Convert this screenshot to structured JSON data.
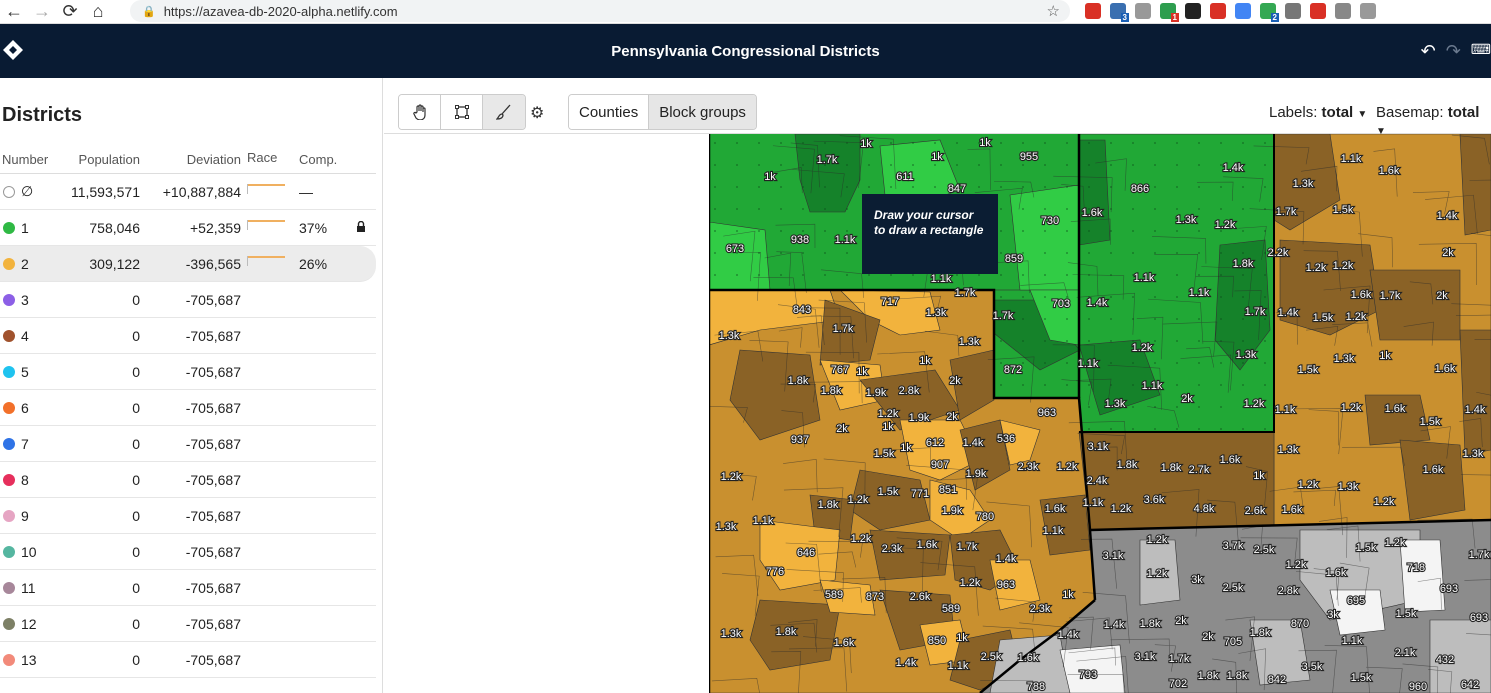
{
  "browser": {
    "url": "https://azavea-db-2020-alpha.netlify.com",
    "extension_badges": [
      "3",
      "1",
      "2"
    ]
  },
  "app": {
    "title": "Pennsylvania Congressional Districts"
  },
  "sidebar": {
    "heading": "Districts",
    "columns": {
      "number": "Number",
      "population": "Population",
      "deviation": "Deviation",
      "race": "Race",
      "comp": "Comp."
    },
    "rows": [
      {
        "number": "∅",
        "color": "#ffffff",
        "population": "11,593,571",
        "deviation": "+10,887,884",
        "comp": "—",
        "locked": false
      },
      {
        "number": "1",
        "color": "#2fb944",
        "population": "758,046",
        "deviation": "+52,359",
        "comp": "37%",
        "locked": true
      },
      {
        "number": "2",
        "color": "#f2b33d",
        "population": "309,122",
        "deviation": "-396,565",
        "comp": "26%",
        "locked": false
      },
      {
        "number": "3",
        "color": "#8c5fe6",
        "population": "0",
        "deviation": "-705,687",
        "comp": "",
        "locked": false
      },
      {
        "number": "4",
        "color": "#a0522d",
        "population": "0",
        "deviation": "-705,687",
        "comp": "",
        "locked": false
      },
      {
        "number": "5",
        "color": "#1fc3ef",
        "population": "0",
        "deviation": "-705,687",
        "comp": "",
        "locked": false
      },
      {
        "number": "6",
        "color": "#f2702a",
        "population": "0",
        "deviation": "-705,687",
        "comp": "",
        "locked": false
      },
      {
        "number": "7",
        "color": "#2f73e6",
        "population": "0",
        "deviation": "-705,687",
        "comp": "",
        "locked": false
      },
      {
        "number": "8",
        "color": "#e62f5c",
        "population": "0",
        "deviation": "-705,687",
        "comp": "",
        "locked": false
      },
      {
        "number": "9",
        "color": "#e6a5c3",
        "population": "0",
        "deviation": "-705,687",
        "comp": "",
        "locked": false
      },
      {
        "number": "10",
        "color": "#55b6a0",
        "population": "0",
        "deviation": "-705,687",
        "comp": "",
        "locked": false
      },
      {
        "number": "11",
        "color": "#a7879a",
        "population": "0",
        "deviation": "-705,687",
        "comp": "",
        "locked": false
      },
      {
        "number": "12",
        "color": "#7d8066",
        "population": "0",
        "deviation": "-705,687",
        "comp": "",
        "locked": false
      },
      {
        "number": "13",
        "color": "#f28a7a",
        "population": "0",
        "deviation": "-705,687",
        "comp": "",
        "locked": false
      }
    ]
  },
  "toolbar": {
    "tools": [
      "pan-icon",
      "rectangle-icon",
      "brush-icon"
    ],
    "active_tool": "brush-icon",
    "geo_levels": [
      "Counties",
      "Block groups"
    ],
    "active_geo_level": "Block groups",
    "labels_label": "Labels:",
    "labels_value": "total",
    "basemap_label": "Basemap:",
    "basemap_value": "total"
  },
  "map": {
    "tooltip": "Draw your cursor to draw a rectangle",
    "colors": {
      "green_dark": "#15822a",
      "green": "#21a836",
      "green_light": "#31cc45",
      "tan": "#c9902f",
      "orange": "#f2b33d",
      "brown": "#8a6226",
      "gray": "#8c8c8c",
      "gray_light": "#bdbdbd",
      "white": "#f4f4f4"
    },
    "labels": [
      [
        "1k",
        770,
        180
      ],
      [
        "1.7k",
        827,
        163
      ],
      [
        "1k",
        866,
        147
      ],
      [
        "1k",
        937,
        160
      ],
      [
        "1k",
        985,
        146
      ],
      [
        "955",
        1029,
        160
      ],
      [
        "611",
        905,
        180
      ],
      [
        "847",
        957,
        192
      ],
      [
        "673",
        735,
        252
      ],
      [
        "938",
        800,
        243
      ],
      [
        "1.1k",
        845,
        243
      ],
      [
        "730",
        1050,
        224
      ],
      [
        "859",
        1014,
        262
      ],
      [
        "1.1k",
        941,
        282
      ],
      [
        "1.7k",
        965,
        296
      ],
      [
        "866",
        1140,
        192
      ],
      [
        "1.4k",
        1233,
        171
      ],
      [
        "1.6k",
        1092,
        216
      ],
      [
        "1.3k",
        1186,
        223
      ],
      [
        "1.2k",
        1225,
        228
      ],
      [
        "1.1k",
        1144,
        281
      ],
      [
        "1.1k",
        1199,
        296
      ],
      [
        "1.8k",
        1243,
        267
      ],
      [
        "1.4k",
        1097,
        306
      ],
      [
        "1.7k",
        1255,
        315
      ],
      [
        "1.2k",
        1142,
        351
      ],
      [
        "1.3k",
        1246,
        358
      ],
      [
        "1.1k",
        1088,
        367
      ],
      [
        "1.1k",
        1152,
        389
      ],
      [
        "1.3k",
        1115,
        407
      ],
      [
        "2k",
        1187,
        402
      ],
      [
        "1.2k",
        1254,
        407
      ],
      [
        "1.1k",
        1351,
        162
      ],
      [
        "1.6k",
        1389,
        174
      ],
      [
        "1.3k",
        1303,
        187
      ],
      [
        "1.7k",
        1286,
        215
      ],
      [
        "1.5k",
        1343,
        213
      ],
      [
        "1.4k",
        1447,
        219
      ],
      [
        "2.2k",
        1278,
        256
      ],
      [
        "1.2k",
        1316,
        271
      ],
      [
        "1.2k",
        1343,
        269
      ],
      [
        "2k",
        1448,
        256
      ],
      [
        "1.6k",
        1361,
        298
      ],
      [
        "1.7k",
        1390,
        299
      ],
      [
        "2k",
        1442,
        299
      ],
      [
        "1.4k",
        1288,
        316
      ],
      [
        "1.5k",
        1323,
        321
      ],
      [
        "1.2k",
        1356,
        320
      ],
      [
        "1.5k",
        1308,
        373
      ],
      [
        "1.3k",
        1344,
        362
      ],
      [
        "1k",
        1385,
        359
      ],
      [
        "1.6k",
        1445,
        372
      ],
      [
        "1.1k",
        1285,
        413
      ],
      [
        "1.2k",
        1351,
        411
      ],
      [
        "1.6k",
        1395,
        412
      ],
      [
        "1.4k",
        1475,
        413
      ],
      [
        "1.5k",
        1430,
        425
      ],
      [
        "1.3k",
        1288,
        453
      ],
      [
        "1.6k",
        1433,
        473
      ],
      [
        "1.3k",
        1473,
        457
      ],
      [
        "1.2k",
        1308,
        488
      ],
      [
        "1.3k",
        1348,
        490
      ],
      [
        "1.2k",
        1384,
        505
      ],
      [
        "843",
        802,
        313
      ],
      [
        "717",
        890,
        305
      ],
      [
        "1.3k",
        936,
        316
      ],
      [
        "1.7k",
        1003,
        319
      ],
      [
        "703",
        1061,
        307
      ],
      [
        "1.3k",
        729,
        339
      ],
      [
        "1.7k",
        843,
        332
      ],
      [
        "1.3k",
        969,
        345
      ],
      [
        "872",
        1013,
        373
      ],
      [
        "1.8k",
        798,
        384
      ],
      [
        "767",
        840,
        373
      ],
      [
        "1k",
        862,
        375
      ],
      [
        "1k",
        925,
        364
      ],
      [
        "2k",
        955,
        384
      ],
      [
        "1.8k",
        831,
        394
      ],
      [
        "1.9k",
        876,
        396
      ],
      [
        "2.8k",
        909,
        394
      ],
      [
        "1.2k",
        888,
        417
      ],
      [
        "1.9k",
        919,
        421
      ],
      [
        "2k",
        952,
        420
      ],
      [
        "963",
        1047,
        416
      ],
      [
        "937",
        800,
        443
      ],
      [
        "2k",
        842,
        432
      ],
      [
        "1k",
        888,
        430
      ],
      [
        "612",
        935,
        446
      ],
      [
        "1.4k",
        973,
        446
      ],
      [
        "536",
        1006,
        442
      ],
      [
        "1.5k",
        884,
        457
      ],
      [
        "1k",
        906,
        451
      ],
      [
        "907",
        940,
        468
      ],
      [
        "1.9k",
        976,
        477
      ],
      [
        "2.3k",
        1028,
        470
      ],
      [
        "1.2k",
        1067,
        470
      ],
      [
        "1.2k",
        731,
        480
      ],
      [
        "1.5k",
        888,
        495
      ],
      [
        "771",
        920,
        497
      ],
      [
        "851",
        948,
        493
      ],
      [
        "1.8k",
        828,
        508
      ],
      [
        "1.2k",
        858,
        503
      ],
      [
        "1.9k",
        952,
        514
      ],
      [
        "780",
        985,
        520
      ],
      [
        "1.6k",
        1055,
        512
      ],
      [
        "1.3k",
        726,
        530
      ],
      [
        "1.1k",
        763,
        524
      ],
      [
        "1.1k",
        1053,
        534
      ],
      [
        "1.2k",
        861,
        542
      ],
      [
        "2.3k",
        892,
        552
      ],
      [
        "1.6k",
        927,
        548
      ],
      [
        "1.7k",
        967,
        550
      ],
      [
        "646",
        806,
        556
      ],
      [
        "1.4k",
        1006,
        562
      ],
      [
        "776",
        775,
        575
      ],
      [
        "589",
        834,
        598
      ],
      [
        "873",
        875,
        600
      ],
      [
        "2.6k",
        920,
        600
      ],
      [
        "1.2k",
        970,
        586
      ],
      [
        "963",
        1006,
        588
      ],
      [
        "1k",
        1068,
        598
      ],
      [
        "589",
        951,
        612
      ],
      [
        "2.3k",
        1040,
        612
      ],
      [
        "1.3k",
        731,
        637
      ],
      [
        "1.8k",
        786,
        635
      ],
      [
        "1.6k",
        844,
        646
      ],
      [
        "850",
        937,
        644
      ],
      [
        "1k",
        962,
        641
      ],
      [
        "1.4k",
        906,
        666
      ],
      [
        "1.1k",
        958,
        669
      ],
      [
        "2.5k",
        991,
        660
      ],
      [
        "1.6k",
        1028,
        661
      ],
      [
        "3.1k",
        1098,
        450
      ],
      [
        "1.8k",
        1127,
        468
      ],
      [
        "1.8k",
        1171,
        471
      ],
      [
        "2.7k",
        1199,
        473
      ],
      [
        "1.6k",
        1230,
        463
      ],
      [
        "1k",
        1259,
        479
      ],
      [
        "2.4k",
        1097,
        484
      ],
      [
        "1.1k",
        1093,
        506
      ],
      [
        "1.2k",
        1121,
        512
      ],
      [
        "3.6k",
        1154,
        503
      ],
      [
        "4.8k",
        1204,
        512
      ],
      [
        "2.6k",
        1255,
        514
      ],
      [
        "1.6k",
        1292,
        513
      ],
      [
        "1.2k",
        1157,
        543
      ],
      [
        "3.1k",
        1113,
        559
      ],
      [
        "1.2k",
        1157,
        577
      ],
      [
        "3.7k",
        1233,
        549
      ],
      [
        "2.5k",
        1264,
        553
      ],
      [
        "1.2k",
        1296,
        568
      ],
      [
        "1.5k",
        1366,
        551
      ],
      [
        "1.2k",
        1395,
        546
      ],
      [
        "1.7k",
        1479,
        558
      ],
      [
        "3k",
        1197,
        583
      ],
      [
        "2.5k",
        1233,
        591
      ],
      [
        "2.8k",
        1288,
        594
      ],
      [
        "1.6k",
        1336,
        576
      ],
      [
        "718",
        1416,
        571
      ],
      [
        "693",
        1449,
        592
      ],
      [
        "695",
        1356,
        604
      ],
      [
        "1.4k",
        1114,
        628
      ],
      [
        "1.8k",
        1150,
        627
      ],
      [
        "2k",
        1181,
        624
      ],
      [
        "2k",
        1208,
        640
      ],
      [
        "705",
        1233,
        645
      ],
      [
        "1.8k",
        1260,
        636
      ],
      [
        "870",
        1300,
        627
      ],
      [
        "3k",
        1333,
        618
      ],
      [
        "1.5k",
        1406,
        617
      ],
      [
        "693",
        1479,
        621
      ],
      [
        "1.4k",
        1068,
        638
      ],
      [
        "1.1k",
        1352,
        644
      ],
      [
        "2.1k",
        1405,
        656
      ],
      [
        "432",
        1445,
        663
      ],
      [
        "793",
        1088,
        678
      ],
      [
        "3.1k",
        1145,
        660
      ],
      [
        "1.7k",
        1179,
        662
      ],
      [
        "1.8k",
        1208,
        679
      ],
      [
        "1.8k",
        1237,
        679
      ],
      [
        "842",
        1277,
        683
      ],
      [
        "3.5k",
        1312,
        670
      ],
      [
        "1.5k",
        1361,
        681
      ],
      [
        "702",
        1178,
        687
      ],
      [
        "788",
        1036,
        690
      ],
      [
        "960",
        1418,
        690
      ],
      [
        "642",
        1470,
        688
      ]
    ]
  }
}
